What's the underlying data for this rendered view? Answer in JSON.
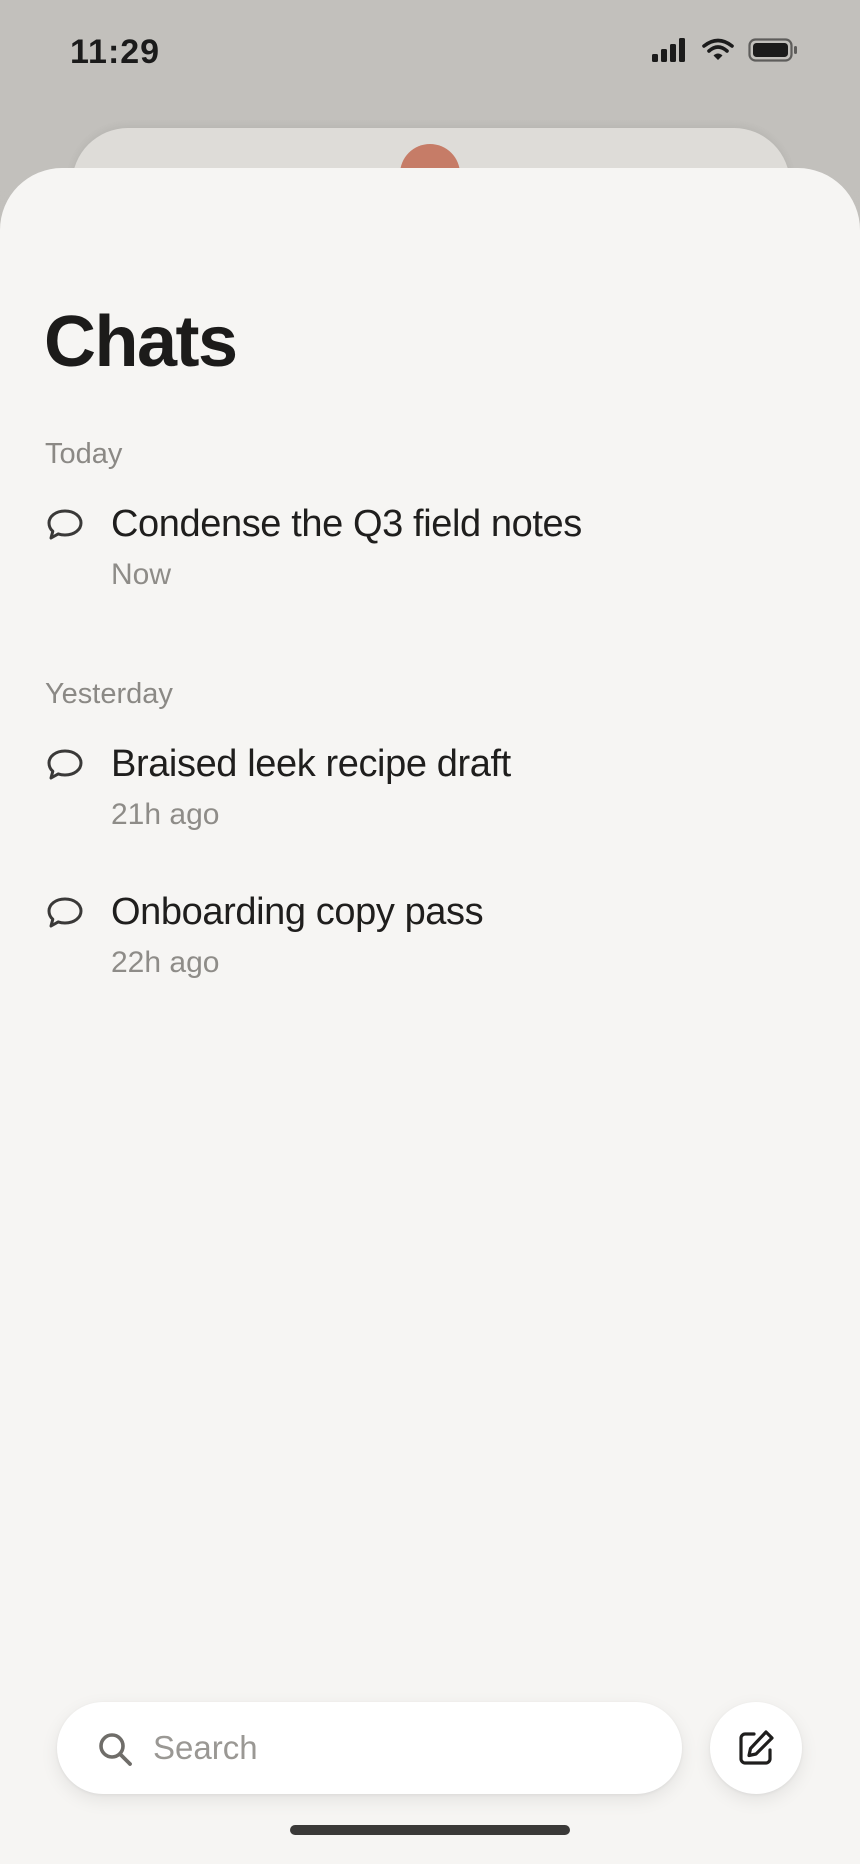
{
  "status_bar": {
    "time": "11:29",
    "icons": [
      "signal-icon",
      "wifi-icon",
      "battery-icon"
    ]
  },
  "page": {
    "title": "Chats"
  },
  "sections": [
    {
      "label": "Today",
      "chats": [
        {
          "title": "Condense the Q3 field notes",
          "time": "Now",
          "icon": "chat-bubble-icon"
        }
      ]
    },
    {
      "label": "Yesterday",
      "chats": [
        {
          "title": "Braised leek recipe draft",
          "time": "21h ago",
          "icon": "chat-bubble-icon"
        },
        {
          "title": "Onboarding copy pass",
          "time": "22h ago",
          "icon": "chat-bubble-icon"
        }
      ]
    }
  ],
  "search": {
    "placeholder": "Search",
    "value": "",
    "icon": "search-icon"
  },
  "compose": {
    "icon": "compose-icon"
  },
  "colors": {
    "background": "#f6f5f3",
    "accent": "#c67c67",
    "text_primary": "#1f1e1d",
    "text_secondary": "#8e8c88"
  }
}
